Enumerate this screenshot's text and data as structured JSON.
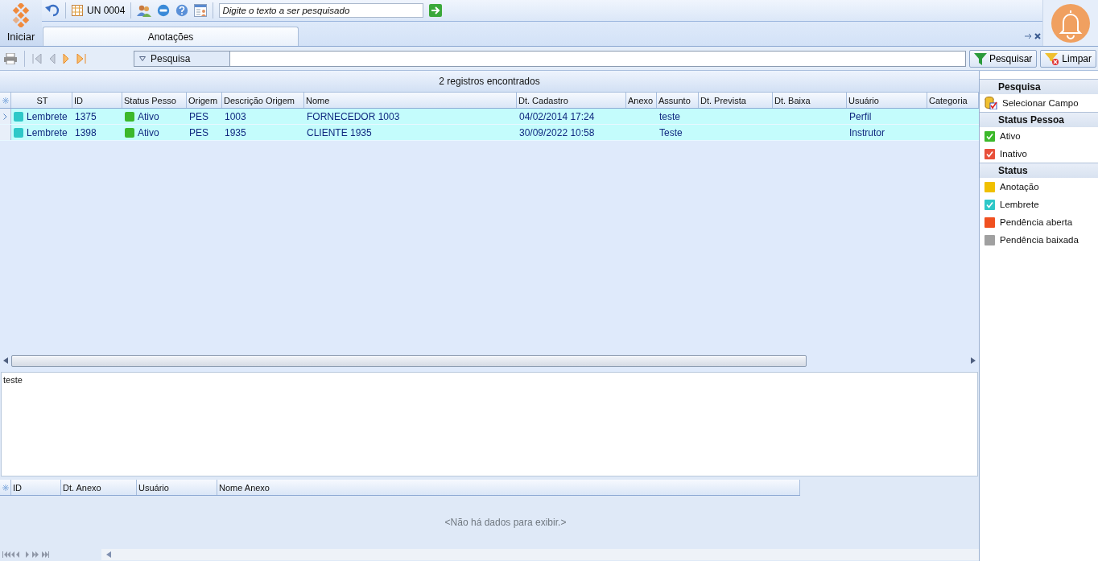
{
  "start": {
    "label": "Iniciar"
  },
  "toolbar": {
    "unit": "UN 0004",
    "search": {
      "placeholder": "Digite o texto a ser pesquisado"
    }
  },
  "tabs": [
    {
      "label": "Anotações",
      "selected": true
    }
  ],
  "filter_bar": {
    "field_label": "Pesquisa",
    "search_button": "Pesquisar",
    "clear_button": "Limpar"
  },
  "grid": {
    "count": "2 registros encontrados",
    "columns": [
      "ST",
      "ID",
      "Status Pesso",
      "Origem",
      "Descrição Origem",
      "Nome",
      "Dt. Cadastro",
      "Anexo",
      "Assunto",
      "Dt. Prevista",
      "Dt. Baixa",
      "Usuário",
      "Categoria"
    ],
    "rows": [
      {
        "selected": true,
        "st": {
          "label": "Lembrete",
          "color": "#2ec8c8"
        },
        "id": "1375",
        "person_status": {
          "label": "Ativo",
          "color": "#3cb82a"
        },
        "origin": "PES",
        "origin_desc": "1003",
        "name": "FORNECEDOR  1003",
        "created": "04/02/2014 17:24",
        "attachment": "",
        "subject": "teste",
        "expected": "",
        "closed": "",
        "user": "Perfil",
        "category": ""
      },
      {
        "selected": false,
        "st": {
          "label": "Lembrete",
          "color": "#2ec8c8"
        },
        "id": "1398",
        "person_status": {
          "label": "Ativo",
          "color": "#3cb82a"
        },
        "origin": "PES",
        "origin_desc": "1935",
        "name": "CLIENTE  1935",
        "created": "30/09/2022 10:58",
        "attachment": "",
        "subject": "Teste",
        "expected": "",
        "closed": "",
        "user": "Instrutor",
        "category": ""
      }
    ]
  },
  "memo": {
    "text": "teste"
  },
  "attachments": {
    "columns": [
      "ID",
      "Dt. Anexo",
      "Usuário",
      "Nome Anexo"
    ],
    "empty": "<Não há dados para exibir.>"
  },
  "side_panel": [
    {
      "title": "Pesquisa",
      "items": [
        {
          "kind": "action",
          "label": "Selecionar Campo"
        }
      ]
    },
    {
      "title": "Status Pessoa",
      "items": [
        {
          "kind": "check",
          "label": "Ativo",
          "color": "#3cb82a"
        },
        {
          "kind": "check",
          "label": "Inativo",
          "color": "#e8503a"
        }
      ]
    },
    {
      "title": "Status",
      "items": [
        {
          "kind": "swatch",
          "label": "Anotação",
          "color": "#f0c000"
        },
        {
          "kind": "check",
          "label": "Lembrete",
          "color": "#2ec8c8"
        },
        {
          "kind": "swatch",
          "label": "Pendência aberta",
          "color": "#f05020"
        },
        {
          "kind": "swatch",
          "label": "Pendência baixada",
          "color": "#a0a0a0"
        }
      ]
    }
  ]
}
